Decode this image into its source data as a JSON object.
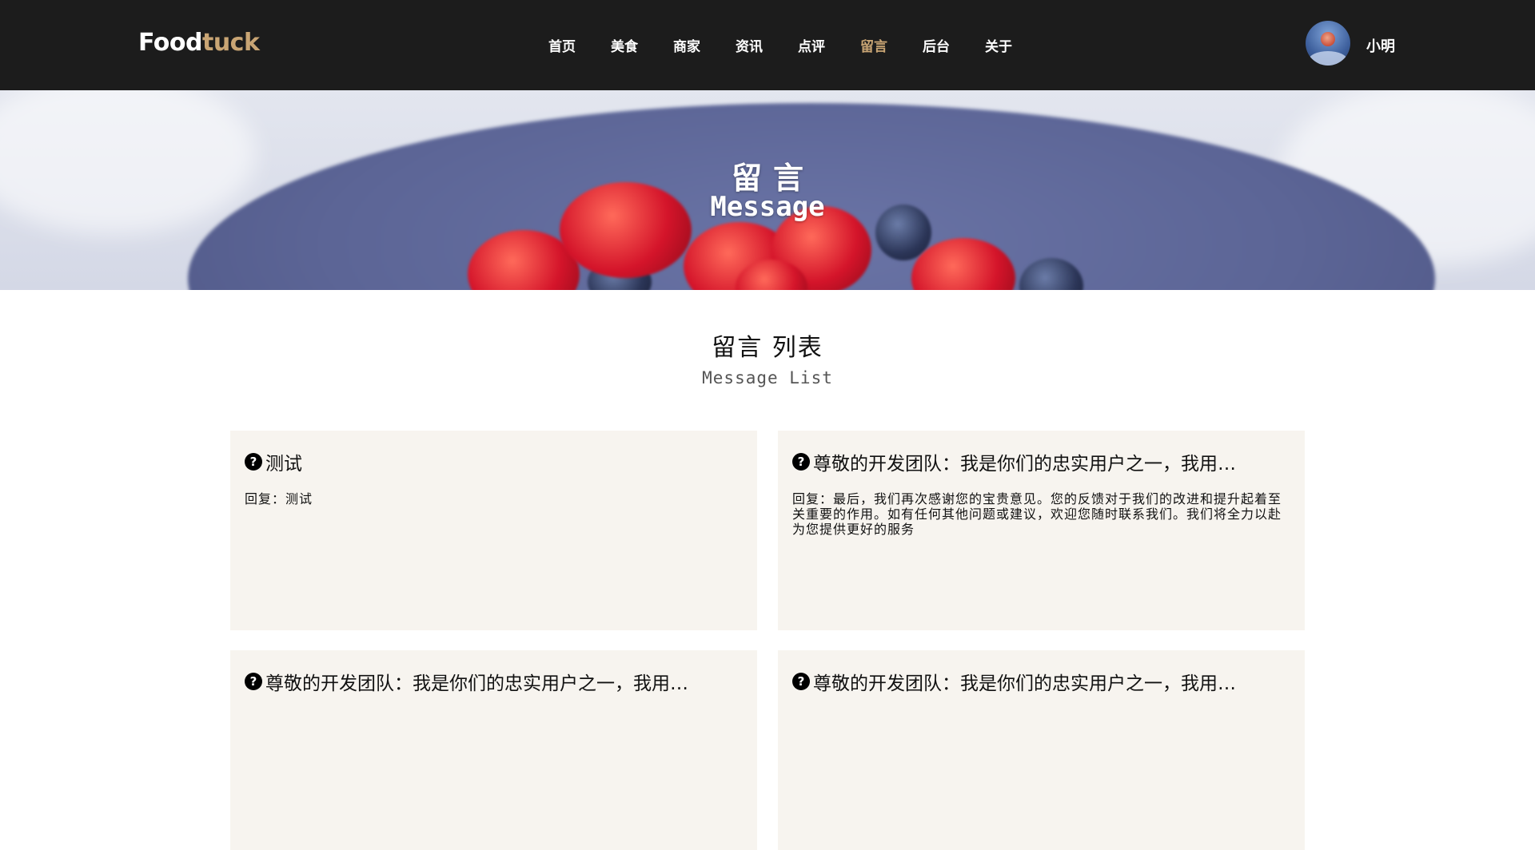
{
  "header": {
    "logo_part1": "Food",
    "logo_part2": "tuck",
    "nav": [
      "首页",
      "美食",
      "商家",
      "资讯",
      "点评",
      "留言",
      "后台",
      "关于"
    ],
    "active_nav": "留言",
    "username": "小明"
  },
  "banner": {
    "title_zh": "留言",
    "title_en": "Message"
  },
  "section": {
    "title": "留言 列表",
    "subtitle": "Message List"
  },
  "messages": [
    {
      "question": "测试",
      "reply": "回复：测试"
    },
    {
      "question": "尊敬的开发团队：我是你们的忠实用户之一，我用…",
      "reply": "回复：最后，我们再次感谢您的宝贵意见。您的反馈对于我们的改进和提升起着至关重要的作用。如有任何其他问题或建议，欢迎您随时联系我们。我们将全力以赴为您提供更好的服务"
    },
    {
      "question": "尊敬的开发团队：我是你们的忠实用户之一，我用…",
      "reply": ""
    },
    {
      "question": "尊敬的开发团队：我是你们的忠实用户之一，我用…",
      "reply": ""
    }
  ],
  "colors": {
    "header_bg": "#1c1c1c",
    "accent": "#c9a574",
    "card_bg": "#f7f4ef"
  },
  "icons": {
    "question": "question-circle-icon",
    "avatar": "user-avatar"
  }
}
